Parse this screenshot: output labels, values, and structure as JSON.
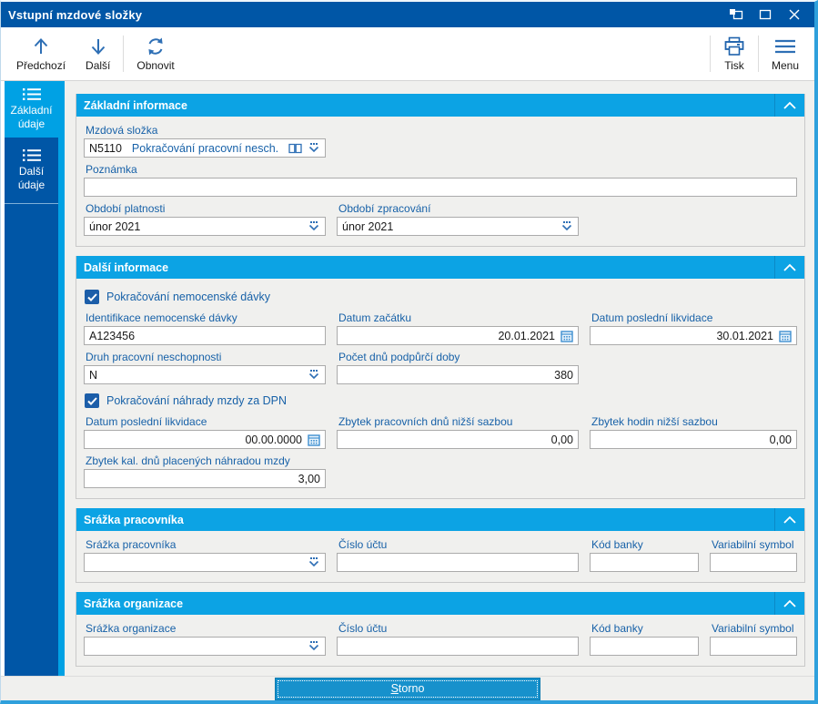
{
  "window": {
    "title": "Vstupní mzdové složky"
  },
  "titlebar": {
    "controls": [
      "restore",
      "maximize",
      "close"
    ]
  },
  "toolbar": {
    "previous": "Předchozí",
    "next": "Další",
    "refresh": "Obnovit",
    "print": "Tisk",
    "menu": "Menu"
  },
  "sidebar": {
    "items": [
      {
        "label": "Základní údaje",
        "selected": true
      },
      {
        "label": "Další údaje",
        "selected": false
      }
    ]
  },
  "sections": {
    "zakladni": {
      "title": "Základní informace",
      "mzdova_slozka": {
        "label": "Mzdová složka",
        "code": "N5110",
        "name": "Pokračování pracovní nesch."
      },
      "poznamka": {
        "label": "Poznámka",
        "value": ""
      },
      "obdobi_platnosti": {
        "label": "Období platnosti",
        "value": "únor 2021"
      },
      "obdobi_zpracovani": {
        "label": "Období zpracování",
        "value": "únor 2021"
      }
    },
    "dalsi": {
      "title": "Další informace",
      "pokracovani_davky": {
        "label": "Pokračování nemocenské dávky",
        "checked": true
      },
      "identifikace": {
        "label": "Identifikace nemocenské dávky",
        "value": "A123456"
      },
      "datum_zacatku": {
        "label": "Datum začátku",
        "value": "20.01.2021"
      },
      "datum_posledni_likvidace": {
        "label": "Datum poslední likvidace",
        "value": "30.01.2021"
      },
      "druh_neschopnosti": {
        "label": "Druh pracovní neschopnosti",
        "value": "N"
      },
      "pocet_dnu": {
        "label": "Počet dnů podpůrčí doby",
        "value": "380"
      },
      "pokracovani_nahrady": {
        "label": "Pokračování náhrady mzdy za DPN",
        "checked": true
      },
      "datum_likvidace_dpn": {
        "label": "Datum poslední likvidace",
        "value": "00.00.0000"
      },
      "zbytek_dnu": {
        "label": "Zbytek pracovních dnů nižší sazbou",
        "value": "0,00"
      },
      "zbytek_hodin": {
        "label": "Zbytek hodin nižší sazbou",
        "value": "0,00"
      },
      "zbytek_kal_dnu": {
        "label": "Zbytek kal. dnů placených náhradou mzdy",
        "value": "3,00"
      }
    },
    "srazka_pracovnika": {
      "title": "Srážka pracovníka",
      "srazka": {
        "label": "Srážka pracovníka",
        "value": ""
      },
      "cislo_uctu": {
        "label": "Číslo účtu",
        "value": ""
      },
      "kod_banky": {
        "label": "Kód banky",
        "value": ""
      },
      "variabilni_symbol": {
        "label": "Variabilní symbol",
        "value": ""
      }
    },
    "srazka_organizace": {
      "title": "Srážka organizace",
      "srazka": {
        "label": "Srážka organizace",
        "value": ""
      },
      "cislo_uctu": {
        "label": "Číslo účtu",
        "value": ""
      },
      "kod_banky": {
        "label": "Kód banky",
        "value": ""
      },
      "variabilni_symbol": {
        "label": "Variabilní symbol",
        "value": ""
      }
    }
  },
  "footer": {
    "storno_key": "S",
    "storno_rest": "torno"
  },
  "icons": {
    "combo-dropdown": "three-dots-over-chevron",
    "catalog-book": "open-book",
    "calendar": "calendar-grid",
    "list": "bulleted-list",
    "refresh": "circular-arrows"
  },
  "colors": {
    "titlebar": "#0056A6",
    "sidebar": "#0056A6",
    "accent_cyan": "#00A1E4",
    "section_header": "#0CA3E4",
    "label_blue": "#1761A8",
    "checkbox_blue": "#1C5EA9",
    "storno_button": "#1791CC",
    "content_bg": "#F0F0EE"
  }
}
